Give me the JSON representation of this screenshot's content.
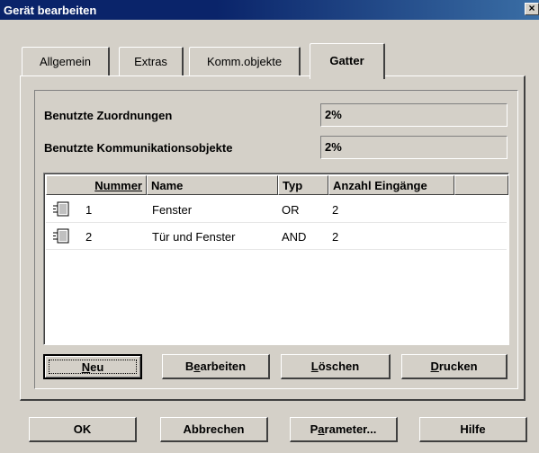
{
  "window": {
    "title": "Gerät bearbeiten",
    "close_glyph": "×"
  },
  "tabs": [
    {
      "label": "Allgemein",
      "active": false
    },
    {
      "label": "Extras",
      "active": false
    },
    {
      "label": "Komm.objekte",
      "active": false
    },
    {
      "label": "Gatter",
      "active": true
    }
  ],
  "usage": {
    "assignments_label": "Benutzte Zuordnungen",
    "assignments_value": "2%",
    "comm_objects_label": "Benutzte Kommunikationsobjekte",
    "comm_objects_value": "2%"
  },
  "gate_list": {
    "columns": [
      "Nummer",
      "Name",
      "Typ",
      "Anzahl Eingänge"
    ],
    "rows": [
      {
        "nummer": "1",
        "name": "Fenster",
        "typ": "OR",
        "eingaenge": "2",
        "icon": "gate-icon"
      },
      {
        "nummer": "2",
        "name": "Tür und Fenster",
        "typ": "AND",
        "eingaenge": "2",
        "icon": "gate-icon"
      }
    ]
  },
  "list_buttons": {
    "neu": {
      "mnemonic": "N",
      "rest": "eu"
    },
    "bearbeiten": {
      "pre": "B",
      "mnemonic": "e",
      "rest": "arbeiten"
    },
    "loeschen": {
      "mnemonic": "L",
      "rest": "öschen"
    },
    "drucken": {
      "mnemonic": "D",
      "rest": "rucken"
    }
  },
  "dialog_buttons": {
    "ok": "OK",
    "cancel": "Abbrechen",
    "parameter": {
      "pre": "P",
      "mnemonic": "a",
      "rest": "rameter..."
    },
    "help": "Hilfe"
  },
  "colors": {
    "face": "#d4d0c8",
    "title_start": "#0a246a",
    "title_end": "#3a6ea5"
  }
}
